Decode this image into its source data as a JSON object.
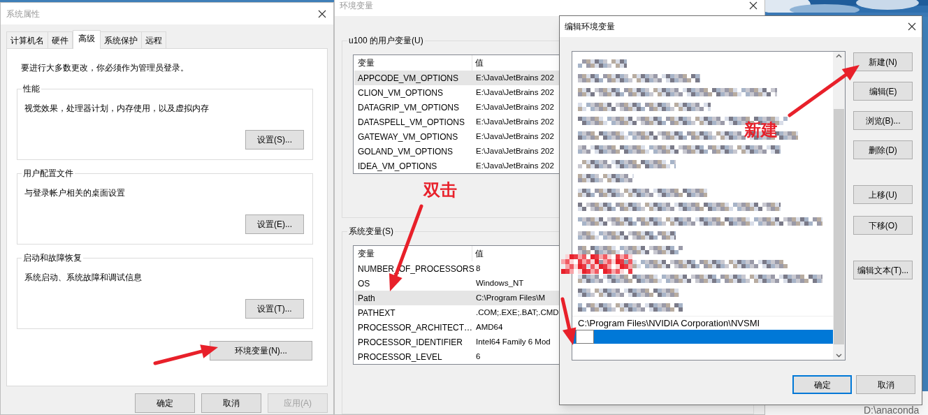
{
  "system_properties": {
    "title": "系统属性",
    "tabs": [
      {
        "label": "计算机名",
        "selected": false
      },
      {
        "label": "硬件",
        "selected": false
      },
      {
        "label": "高级",
        "selected": true
      },
      {
        "label": "系统保护",
        "selected": false
      },
      {
        "label": "远程",
        "selected": false
      }
    ],
    "notice": "要进行大多数更改，你必须作为管理员登录。",
    "groups": [
      {
        "title": "性能",
        "description": "视觉效果，处理器计划，内存使用，以及虚拟内存",
        "button": "设置(S)..."
      },
      {
        "title": "用户配置文件",
        "description": "与登录帐户相关的桌面设置",
        "button": "设置(E)..."
      },
      {
        "title": "启动和故障恢复",
        "description": "系统启动、系统故障和调试信息",
        "button": "设置(T)..."
      }
    ],
    "env_button": "环境变量(N)...",
    "buttons": [
      {
        "label": "确定",
        "disabled": false
      },
      {
        "label": "取消",
        "disabled": false
      },
      {
        "label": "应用(A)",
        "disabled": true
      }
    ]
  },
  "environment_variables": {
    "title": "环境变量",
    "user_group": {
      "title": "u100 的用户变量(U)",
      "columns": [
        "变量",
        "值"
      ],
      "rows": [
        {
          "name": "APPCODE_VM_OPTIONS",
          "value": "E:\\Java\\JetBrains 202",
          "selected": true
        },
        {
          "name": "CLION_VM_OPTIONS",
          "value": "E:\\Java\\JetBrains 202",
          "selected": false
        },
        {
          "name": "DATAGRIP_VM_OPTIONS",
          "value": "E:\\Java\\JetBrains 202",
          "selected": false
        },
        {
          "name": "DATASPELL_VM_OPTIONS",
          "value": "E:\\Java\\JetBrains 202",
          "selected": false
        },
        {
          "name": "GATEWAY_VM_OPTIONS",
          "value": "E:\\Java\\JetBrains 202",
          "selected": false
        },
        {
          "name": "GOLAND_VM_OPTIONS",
          "value": "E:\\Java\\JetBrains 202",
          "selected": false
        },
        {
          "name": "IDEA_VM_OPTIONS",
          "value": "E:\\Java\\JetBrains 202",
          "selected": false
        }
      ]
    },
    "system_group": {
      "title": "系统变量(S)",
      "columns": [
        "变量",
        "值"
      ],
      "rows": [
        {
          "name": "NUMBER_OF_PROCESSORS",
          "value": "8",
          "selected": false
        },
        {
          "name": "OS",
          "value": "Windows_NT",
          "selected": false
        },
        {
          "name": "Path",
          "value": "C:\\Program Files\\M",
          "selected": true
        },
        {
          "name": "PATHEXT",
          "value": ".COM;.EXE;.BAT;.CMD",
          "selected": false
        },
        {
          "name": "PROCESSOR_ARCHITECT…",
          "value": "AMD64",
          "selected": false
        },
        {
          "name": "PROCESSOR_IDENTIFIER",
          "value": "Intel64 Family 6 Mod",
          "selected": false
        },
        {
          "name": "PROCESSOR_LEVEL",
          "value": "6",
          "selected": false
        }
      ]
    }
  },
  "edit_dialog": {
    "title": "编辑环境变量",
    "entries": [
      {
        "kind": "redacted",
        "selected": false
      },
      {
        "kind": "redacted",
        "selected": false
      },
      {
        "kind": "redacted",
        "selected": false
      },
      {
        "kind": "redacted",
        "selected": false
      },
      {
        "kind": "redacted",
        "selected": false
      },
      {
        "kind": "redacted",
        "selected": false
      },
      {
        "kind": "redacted",
        "selected": false
      },
      {
        "kind": "redacted",
        "selected": false
      },
      {
        "kind": "redacted",
        "selected": false
      },
      {
        "kind": "redacted",
        "selected": false
      },
      {
        "kind": "redacted",
        "selected": false
      },
      {
        "kind": "redacted",
        "selected": false
      },
      {
        "kind": "redacted",
        "selected": false
      },
      {
        "kind": "redacted",
        "selected": false
      },
      {
        "kind": "redacted",
        "selected": false
      },
      {
        "kind": "redacted",
        "selected": false
      },
      {
        "kind": "redacted",
        "selected": false
      },
      {
        "kind": "redacted",
        "selected": false
      },
      {
        "kind": "text",
        "text": "C:\\Program Files\\NVIDIA Corporation\\NVSMI",
        "selected": false
      },
      {
        "kind": "editing",
        "selected": true
      }
    ],
    "side_buttons": [
      "新建(N)",
      "编辑(E)",
      "浏览(B)...",
      "删除(D)",
      "上移(U)",
      "下移(O)",
      "编辑文本(T)..."
    ],
    "buttons": [
      {
        "label": "确定",
        "default": true
      },
      {
        "label": "取消",
        "default": false
      }
    ]
  },
  "background_text": "D:\\anaconda",
  "annotations": [
    {
      "kind": "label",
      "text": "双击"
    },
    {
      "kind": "label",
      "text": "新建"
    },
    {
      "kind": "arrow"
    },
    {
      "kind": "arrow"
    },
    {
      "kind": "arrow"
    },
    {
      "kind": "arrow"
    },
    {
      "kind": "pixelated"
    }
  ]
}
